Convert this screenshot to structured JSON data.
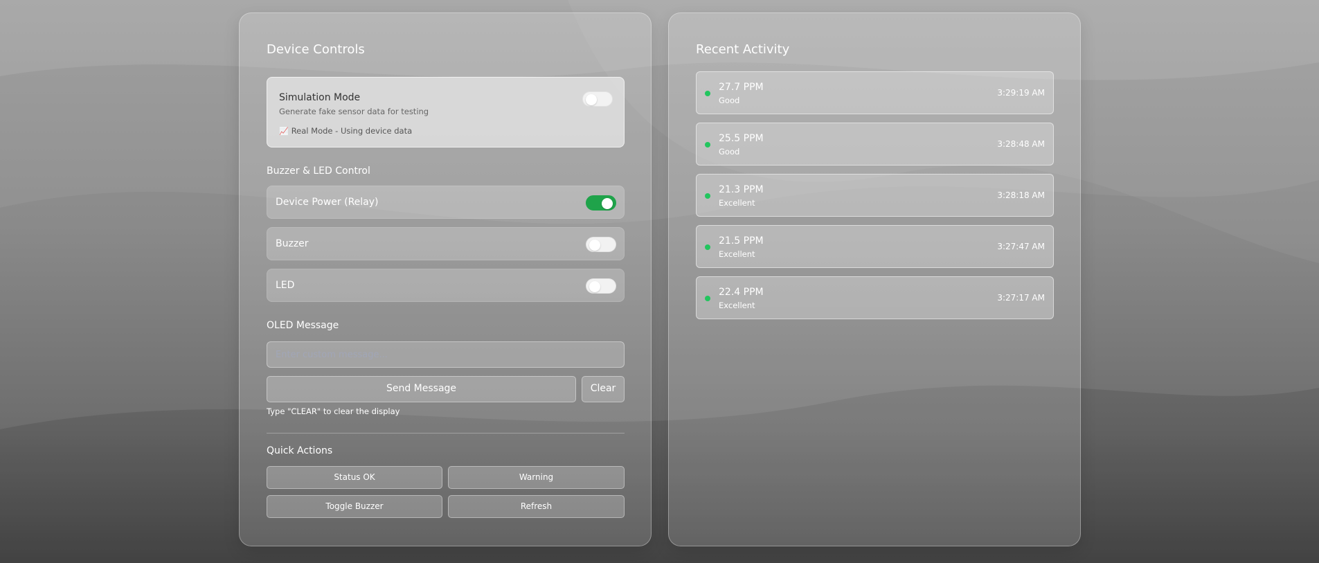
{
  "device_controls": {
    "title": "Device Controls",
    "simulation": {
      "title": "Simulation Mode",
      "description": "Generate fake sensor data for testing",
      "mode_icon": "chart-icon",
      "mode_glyph": "📈",
      "mode_text": "Real Mode - Using device data",
      "enabled": false
    },
    "buzzer_led": {
      "label": "Buzzer & LED Control",
      "items": [
        {
          "label": "Device Power (Relay)",
          "on": true
        },
        {
          "label": "Buzzer",
          "on": false
        },
        {
          "label": "LED",
          "on": false
        }
      ]
    },
    "oled": {
      "label": "OLED Message",
      "placeholder": "Enter custom message...",
      "value": "",
      "send_label": "Send Message",
      "clear_label": "Clear",
      "hint": "Type \"CLEAR\" to clear the display"
    },
    "quick_actions": {
      "label": "Quick Actions",
      "buttons": [
        "Status OK",
        "Warning",
        "Toggle Buzzer",
        "Refresh"
      ]
    }
  },
  "recent_activity": {
    "title": "Recent Activity",
    "items": [
      {
        "ppm": "27.7 PPM",
        "status": "Good",
        "time": "3:29:19 AM"
      },
      {
        "ppm": "25.5 PPM",
        "status": "Good",
        "time": "3:28:48 AM"
      },
      {
        "ppm": "21.3 PPM",
        "status": "Excellent",
        "time": "3:28:18 AM"
      },
      {
        "ppm": "21.5 PPM",
        "status": "Excellent",
        "time": "3:27:47 AM"
      },
      {
        "ppm": "22.4 PPM",
        "status": "Excellent",
        "time": "3:27:17 AM"
      }
    ]
  },
  "colors": {
    "toggle_on": "#1fa34a",
    "status_dot": "#22c55e"
  }
}
